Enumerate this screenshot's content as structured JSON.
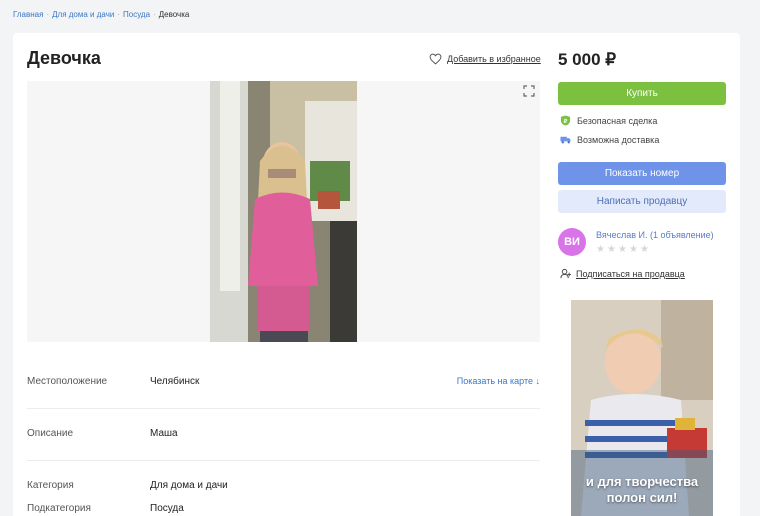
{
  "breadcrumb": {
    "items": [
      "Главная",
      "Для дома и дачи",
      "Посуда"
    ],
    "current": "Девочка",
    "separator": "·"
  },
  "listing": {
    "title": "Девочка",
    "favorite_label": "Добавить в избранное",
    "price": "5 000 ₽"
  },
  "actions": {
    "buy_label": "Купить",
    "safe_deal": "Безопасная сделка",
    "delivery": "Возможна доставка",
    "show_phone": "Показать номер",
    "write_seller": "Написать продавцу",
    "subscribe": "Подписаться на продавца"
  },
  "seller": {
    "initials": "ВИ",
    "name": "Вячеслав И. (1 объявление)",
    "rating_stars": 5,
    "avatar_color": "#d974e8"
  },
  "details": {
    "location_key": "Местоположение",
    "location_value": "Челябинск",
    "map_link": "Показать на карте ↓",
    "description_key": "Описание",
    "description_value": "Маша",
    "category_key": "Категория",
    "category_value": "Для дома и дачи",
    "subcategory_key": "Подкатегория",
    "subcategory_value": "Посуда"
  },
  "ad": {
    "line1": "и для творчества",
    "line2": "полон сил!"
  },
  "colors": {
    "buy": "#7bc13f",
    "phone": "#6e93e8",
    "write_bg": "#e3eafc",
    "link": "#3a78c4"
  }
}
